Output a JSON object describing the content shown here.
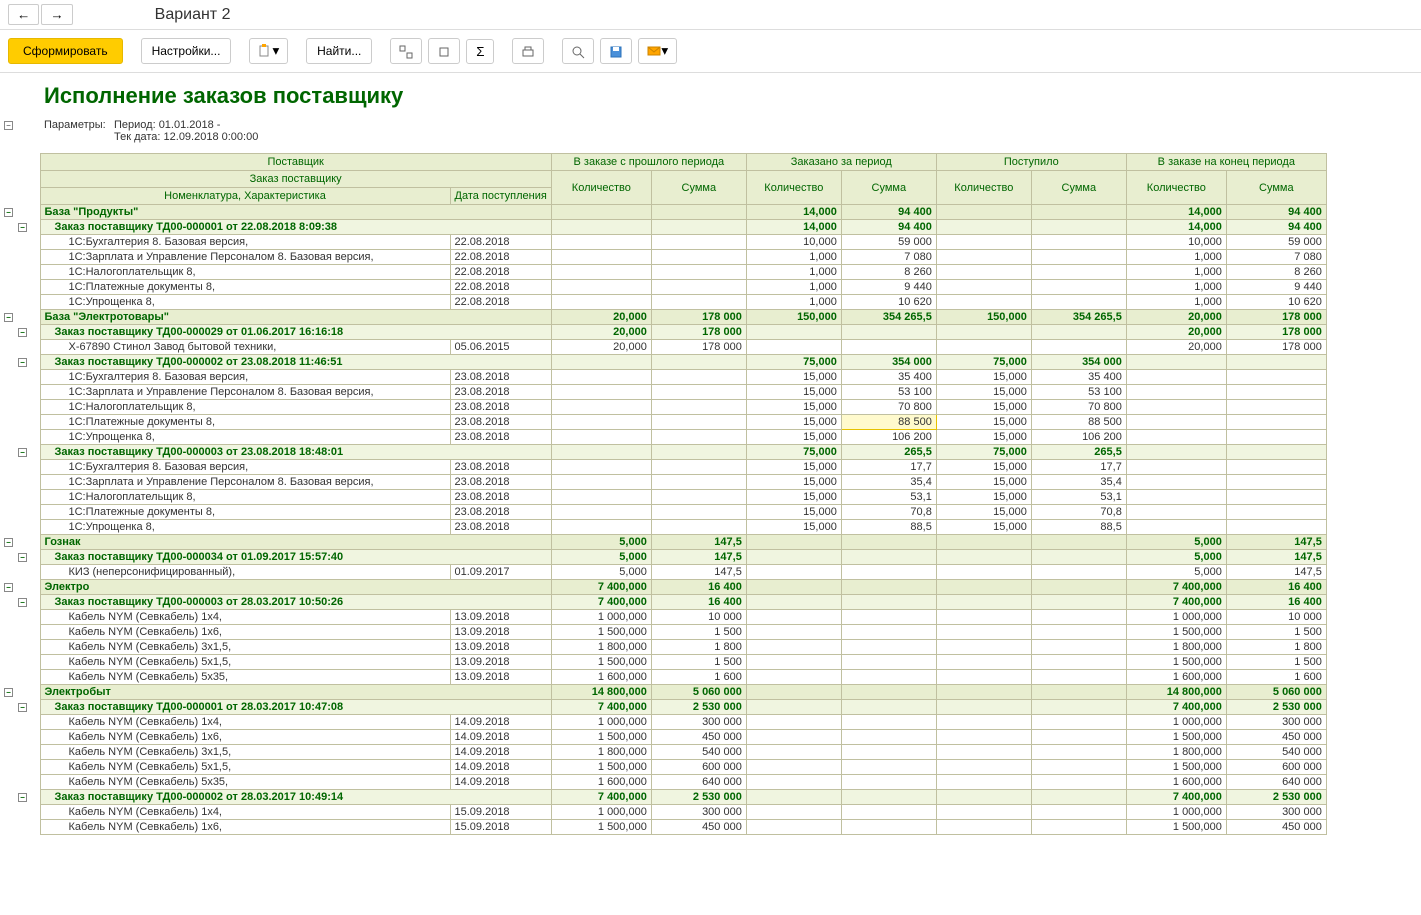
{
  "window": {
    "title": "Вариант 2"
  },
  "toolbar": {
    "form": "Сформировать",
    "settings": "Настройки...",
    "find": "Найти..."
  },
  "report": {
    "title": "Исполнение заказов поставщику",
    "params_label": "Параметры:",
    "params_period": "Период: 01.01.2018 -",
    "params_tek": "Тек дата: 12.09.2018 0:00:00"
  },
  "headers": {
    "supplier": "Поставщик",
    "order": "Заказ поставщику",
    "nomen": "Номенклатура, Характеристика",
    "date": "Дата поступления",
    "prev": "В заказе с прошлого периода",
    "ordered": "Заказано за период",
    "received": "Поступило",
    "end": "В заказе на конец периода",
    "qty": "Количество",
    "sum": "Сумма"
  },
  "rows": [
    {
      "lvl": 0,
      "name": "База \"Продукты\"",
      "c": [
        "",
        "",
        "14,000",
        "94 400",
        "",
        "",
        "14,000",
        "94 400"
      ]
    },
    {
      "lvl": 1,
      "name": "Заказ поставщику ТД00-000001 от 22.08.2018 8:09:38",
      "c": [
        "",
        "",
        "14,000",
        "94 400",
        "",
        "",
        "14,000",
        "94 400"
      ]
    },
    {
      "lvl": 2,
      "name": "1С:Бухгалтерия 8. Базовая версия,",
      "d": "22.08.2018",
      "c": [
        "",
        "",
        "10,000",
        "59 000",
        "",
        "",
        "10,000",
        "59 000"
      ]
    },
    {
      "lvl": 2,
      "name": "1С:Зарплата и Управление Персоналом 8. Базовая версия,",
      "d": "22.08.2018",
      "c": [
        "",
        "",
        "1,000",
        "7 080",
        "",
        "",
        "1,000",
        "7 080"
      ]
    },
    {
      "lvl": 2,
      "name": "1С:Налогоплательщик 8,",
      "d": "22.08.2018",
      "c": [
        "",
        "",
        "1,000",
        "8 260",
        "",
        "",
        "1,000",
        "8 260"
      ]
    },
    {
      "lvl": 2,
      "name": "1С:Платежные документы 8,",
      "d": "22.08.2018",
      "c": [
        "",
        "",
        "1,000",
        "9 440",
        "",
        "",
        "1,000",
        "9 440"
      ]
    },
    {
      "lvl": 2,
      "name": "1С:Упрощенка 8,",
      "d": "22.08.2018",
      "c": [
        "",
        "",
        "1,000",
        "10 620",
        "",
        "",
        "1,000",
        "10 620"
      ]
    },
    {
      "lvl": 0,
      "name": "База \"Электротовары\"",
      "c": [
        "20,000",
        "178 000",
        "150,000",
        "354 265,5",
        "150,000",
        "354 265,5",
        "20,000",
        "178 000"
      ]
    },
    {
      "lvl": 1,
      "name": "Заказ поставщику ТД00-000029 от 01.06.2017 16:16:18",
      "c": [
        "20,000",
        "178 000",
        "",
        "",
        "",
        "",
        "20,000",
        "178 000"
      ]
    },
    {
      "lvl": 2,
      "name": "Х-67890 Стинол Завод бытовой техники,",
      "d": "05.06.2015",
      "c": [
        "20,000",
        "178 000",
        "",
        "",
        "",
        "",
        "20,000",
        "178 000"
      ]
    },
    {
      "lvl": 1,
      "name": "Заказ поставщику ТД00-000002 от 23.08.2018 11:46:51",
      "c": [
        "",
        "",
        "75,000",
        "354 000",
        "75,000",
        "354 000",
        "",
        ""
      ]
    },
    {
      "lvl": 2,
      "name": "1С:Бухгалтерия 8. Базовая версия,",
      "d": "23.08.2018",
      "c": [
        "",
        "",
        "15,000",
        "35 400",
        "15,000",
        "35 400",
        "",
        ""
      ]
    },
    {
      "lvl": 2,
      "name": "1С:Зарплата и Управление Персоналом 8. Базовая версия,",
      "d": "23.08.2018",
      "c": [
        "",
        "",
        "15,000",
        "53 100",
        "15,000",
        "53 100",
        "",
        ""
      ]
    },
    {
      "lvl": 2,
      "name": "1С:Налогоплательщик 8,",
      "d": "23.08.2018",
      "c": [
        "",
        "",
        "15,000",
        "70 800",
        "15,000",
        "70 800",
        "",
        ""
      ]
    },
    {
      "lvl": 2,
      "name": "1С:Платежные документы 8,",
      "d": "23.08.2018",
      "c": [
        "",
        "",
        "15,000",
        "88 500",
        "15,000",
        "88 500",
        "",
        ""
      ],
      "sel": 3
    },
    {
      "lvl": 2,
      "name": "1С:Упрощенка 8,",
      "d": "23.08.2018",
      "c": [
        "",
        "",
        "15,000",
        "106 200",
        "15,000",
        "106 200",
        "",
        ""
      ]
    },
    {
      "lvl": 1,
      "name": "Заказ поставщику ТД00-000003 от 23.08.2018 18:48:01",
      "c": [
        "",
        "",
        "75,000",
        "265,5",
        "75,000",
        "265,5",
        "",
        ""
      ]
    },
    {
      "lvl": 2,
      "name": "1С:Бухгалтерия 8. Базовая версия,",
      "d": "23.08.2018",
      "c": [
        "",
        "",
        "15,000",
        "17,7",
        "15,000",
        "17,7",
        "",
        ""
      ]
    },
    {
      "lvl": 2,
      "name": "1С:Зарплата и Управление Персоналом 8. Базовая версия,",
      "d": "23.08.2018",
      "c": [
        "",
        "",
        "15,000",
        "35,4",
        "15,000",
        "35,4",
        "",
        ""
      ]
    },
    {
      "lvl": 2,
      "name": "1С:Налогоплательщик 8,",
      "d": "23.08.2018",
      "c": [
        "",
        "",
        "15,000",
        "53,1",
        "15,000",
        "53,1",
        "",
        ""
      ]
    },
    {
      "lvl": 2,
      "name": "1С:Платежные документы 8,",
      "d": "23.08.2018",
      "c": [
        "",
        "",
        "15,000",
        "70,8",
        "15,000",
        "70,8",
        "",
        ""
      ]
    },
    {
      "lvl": 2,
      "name": "1С:Упрощенка 8,",
      "d": "23.08.2018",
      "c": [
        "",
        "",
        "15,000",
        "88,5",
        "15,000",
        "88,5",
        "",
        ""
      ]
    },
    {
      "lvl": 0,
      "name": "Гознак",
      "c": [
        "5,000",
        "147,5",
        "",
        "",
        "",
        "",
        "5,000",
        "147,5"
      ]
    },
    {
      "lvl": 1,
      "name": "Заказ поставщику ТД00-000034 от 01.09.2017 15:57:40",
      "c": [
        "5,000",
        "147,5",
        "",
        "",
        "",
        "",
        "5,000",
        "147,5"
      ]
    },
    {
      "lvl": 2,
      "name": "КИЗ (неперсонифицированный),",
      "d": "01.09.2017",
      "c": [
        "5,000",
        "147,5",
        "",
        "",
        "",
        "",
        "5,000",
        "147,5"
      ]
    },
    {
      "lvl": 0,
      "name": "Электро",
      "c": [
        "7 400,000",
        "16 400",
        "",
        "",
        "",
        "",
        "7 400,000",
        "16 400"
      ]
    },
    {
      "lvl": 1,
      "name": "Заказ поставщику ТД00-000003 от 28.03.2017 10:50:26",
      "c": [
        "7 400,000",
        "16 400",
        "",
        "",
        "",
        "",
        "7 400,000",
        "16 400"
      ]
    },
    {
      "lvl": 2,
      "name": "Кабель NYM (Севкабель) 1х4,",
      "d": "13.09.2018",
      "c": [
        "1 000,000",
        "10 000",
        "",
        "",
        "",
        "",
        "1 000,000",
        "10 000"
      ]
    },
    {
      "lvl": 2,
      "name": "Кабель NYM (Севкабель) 1х6,",
      "d": "13.09.2018",
      "c": [
        "1 500,000",
        "1 500",
        "",
        "",
        "",
        "",
        "1 500,000",
        "1 500"
      ]
    },
    {
      "lvl": 2,
      "name": "Кабель NYM (Севкабель) 3х1,5,",
      "d": "13.09.2018",
      "c": [
        "1 800,000",
        "1 800",
        "",
        "",
        "",
        "",
        "1 800,000",
        "1 800"
      ]
    },
    {
      "lvl": 2,
      "name": "Кабель NYM (Севкабель) 5х1,5,",
      "d": "13.09.2018",
      "c": [
        "1 500,000",
        "1 500",
        "",
        "",
        "",
        "",
        "1 500,000",
        "1 500"
      ]
    },
    {
      "lvl": 2,
      "name": "Кабель NYM (Севкабель) 5х35,",
      "d": "13.09.2018",
      "c": [
        "1 600,000",
        "1 600",
        "",
        "",
        "",
        "",
        "1 600,000",
        "1 600"
      ]
    },
    {
      "lvl": 0,
      "name": "Электробыт",
      "c": [
        "14 800,000",
        "5 060 000",
        "",
        "",
        "",
        "",
        "14 800,000",
        "5 060 000"
      ]
    },
    {
      "lvl": 1,
      "name": "Заказ поставщику ТД00-000001 от 28.03.2017 10:47:08",
      "c": [
        "7 400,000",
        "2 530 000",
        "",
        "",
        "",
        "",
        "7 400,000",
        "2 530 000"
      ]
    },
    {
      "lvl": 2,
      "name": "Кабель NYM (Севкабель) 1х4,",
      "d": "14.09.2018",
      "c": [
        "1 000,000",
        "300 000",
        "",
        "",
        "",
        "",
        "1 000,000",
        "300 000"
      ]
    },
    {
      "lvl": 2,
      "name": "Кабель NYM (Севкабель) 1х6,",
      "d": "14.09.2018",
      "c": [
        "1 500,000",
        "450 000",
        "",
        "",
        "",
        "",
        "1 500,000",
        "450 000"
      ]
    },
    {
      "lvl": 2,
      "name": "Кабель NYM (Севкабель) 3х1,5,",
      "d": "14.09.2018",
      "c": [
        "1 800,000",
        "540 000",
        "",
        "",
        "",
        "",
        "1 800,000",
        "540 000"
      ]
    },
    {
      "lvl": 2,
      "name": "Кабель NYM (Севкабель) 5х1,5,",
      "d": "14.09.2018",
      "c": [
        "1 500,000",
        "600 000",
        "",
        "",
        "",
        "",
        "1 500,000",
        "600 000"
      ]
    },
    {
      "lvl": 2,
      "name": "Кабель NYM (Севкабель) 5х35,",
      "d": "14.09.2018",
      "c": [
        "1 600,000",
        "640 000",
        "",
        "",
        "",
        "",
        "1 600,000",
        "640 000"
      ]
    },
    {
      "lvl": 1,
      "name": "Заказ поставщику ТД00-000002 от 28.03.2017 10:49:14",
      "c": [
        "7 400,000",
        "2 530 000",
        "",
        "",
        "",
        "",
        "7 400,000",
        "2 530 000"
      ]
    },
    {
      "lvl": 2,
      "name": "Кабель NYM (Севкабель) 1х4,",
      "d": "15.09.2018",
      "c": [
        "1 000,000",
        "300 000",
        "",
        "",
        "",
        "",
        "1 000,000",
        "300 000"
      ]
    },
    {
      "lvl": 2,
      "name": "Кабель NYM (Севкабель) 1х6,",
      "d": "15.09.2018",
      "c": [
        "1 500,000",
        "450 000",
        "",
        "",
        "",
        "",
        "1 500,000",
        "450 000"
      ]
    }
  ]
}
